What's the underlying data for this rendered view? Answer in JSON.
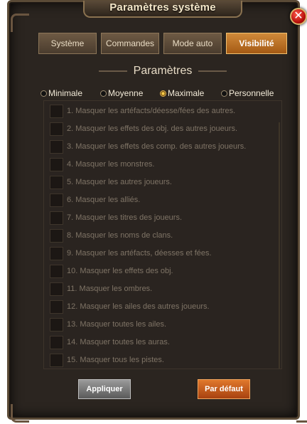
{
  "window": {
    "title": "Paramètres système"
  },
  "tabs": [
    {
      "label": "Système"
    },
    {
      "label": "Commandes"
    },
    {
      "label": "Mode auto"
    },
    {
      "label": "Visibilité",
      "active": true
    }
  ],
  "section": {
    "title": "Paramètres"
  },
  "modes": [
    {
      "label": "Minimale",
      "selected": false
    },
    {
      "label": "Moyenne",
      "selected": false
    },
    {
      "label": "Maximale",
      "selected": true
    },
    {
      "label": "Personnelle",
      "selected": false
    }
  ],
  "options": [
    {
      "label": "1. Masquer les artéfacts/déesse/fées des autres.",
      "checked": false
    },
    {
      "label": "2. Masquer les effets des obj. des autres joueurs.",
      "checked": false
    },
    {
      "label": "3. Masquer les effets des comp. des autres joueurs.",
      "checked": false
    },
    {
      "label": "4. Masquer les monstres.",
      "checked": false
    },
    {
      "label": "5. Masquer les autres joueurs.",
      "checked": false
    },
    {
      "label": "6. Masquer les alliés.",
      "checked": false
    },
    {
      "label": "7. Masquer les titres des joueurs.",
      "checked": false
    },
    {
      "label": "8. Masquer les noms de clans.",
      "checked": false
    },
    {
      "label": "9. Masquer les artéfacts, déesses et fées.",
      "checked": false
    },
    {
      "label": "10. Masquer les effets des obj.",
      "checked": false
    },
    {
      "label": "11. Masquer les ombres.",
      "checked": false
    },
    {
      "label": "12. Masquer les ailes des autres joueurs.",
      "checked": false
    },
    {
      "label": "13. Masquer toutes les ailes.",
      "checked": false
    },
    {
      "label": "14. Masquer toutes les auras.",
      "checked": false
    },
    {
      "label": "15. Masquer tous les pistes.",
      "checked": false
    }
  ],
  "buttons": {
    "apply": "Appliquer",
    "default": "Par défaut"
  },
  "colors": {
    "accent": "#c07030",
    "active_tab": "#b8681e",
    "panel_bg": "#2b2520"
  }
}
